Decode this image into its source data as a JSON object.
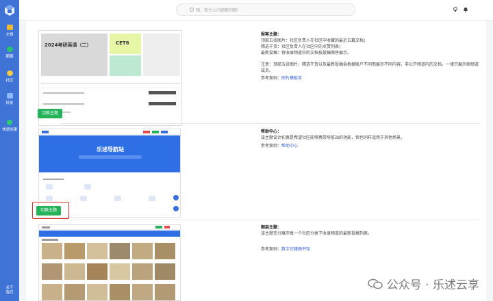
{
  "sidebar": {
    "items": [
      {
        "label": "文档",
        "color": "#f5b731"
      },
      {
        "label": "圈圈",
        "color": "#29c16b"
      },
      {
        "label": "社区",
        "color": "#f7c948"
      },
      {
        "label": "好友",
        "color": "#8fb8ff"
      },
      {
        "label": "快速创建",
        "color": "#2ecc71"
      }
    ],
    "about_label_1": "关于",
    "about_label_2": "我们"
  },
  "topbar": {
    "search_placeholder": "嗨，我什么问题都问哦！"
  },
  "themes": [
    {
      "thumb_title": "2024考研英语（二）",
      "thumb_badge": "CET6",
      "switch_label": "切换主题",
      "heading": "报客主题：",
      "lines": [
        "顶部五张图片：社区负责人在社区中收藏的最近五篇文档；",
        "精选干货：社区负责人在社区中的点赞列表；",
        "最新投稿：将收录频道中的文档按投稿顺序展示。"
      ],
      "note": "注意：顶部五张图片，精选干货以及最新投稿会根据账户不同而展示不同内容，非公开频道内的文档，一律只展示给频道成员。",
      "ref_label": "参考案例：",
      "ref_link": "图片模板库"
    },
    {
      "thumb_title": "乐述导航站",
      "switch_label": "切换主题",
      "heading": "帮助中心：",
      "lines": [
        "该主题设计初衷是希望社区能够携带导航站的功能，但也同样适用于其他场景。"
      ],
      "ref_label": "参考案例：",
      "ref_link": "帮助中心"
    },
    {
      "heading": "图层主题：",
      "lines": [
        "该主题充分展示每一个社区分类下收录频道的最新投稿列表。"
      ],
      "ref_label": "参考案例：",
      "ref_link": "数字古籍图书馆"
    }
  ],
  "watermark": "公众号 · 乐述云享",
  "colors": {
    "sidebar": "#3f73d6",
    "accent_green": "#24b35a",
    "link": "#3a63d6",
    "highlight": "#d9342b"
  }
}
